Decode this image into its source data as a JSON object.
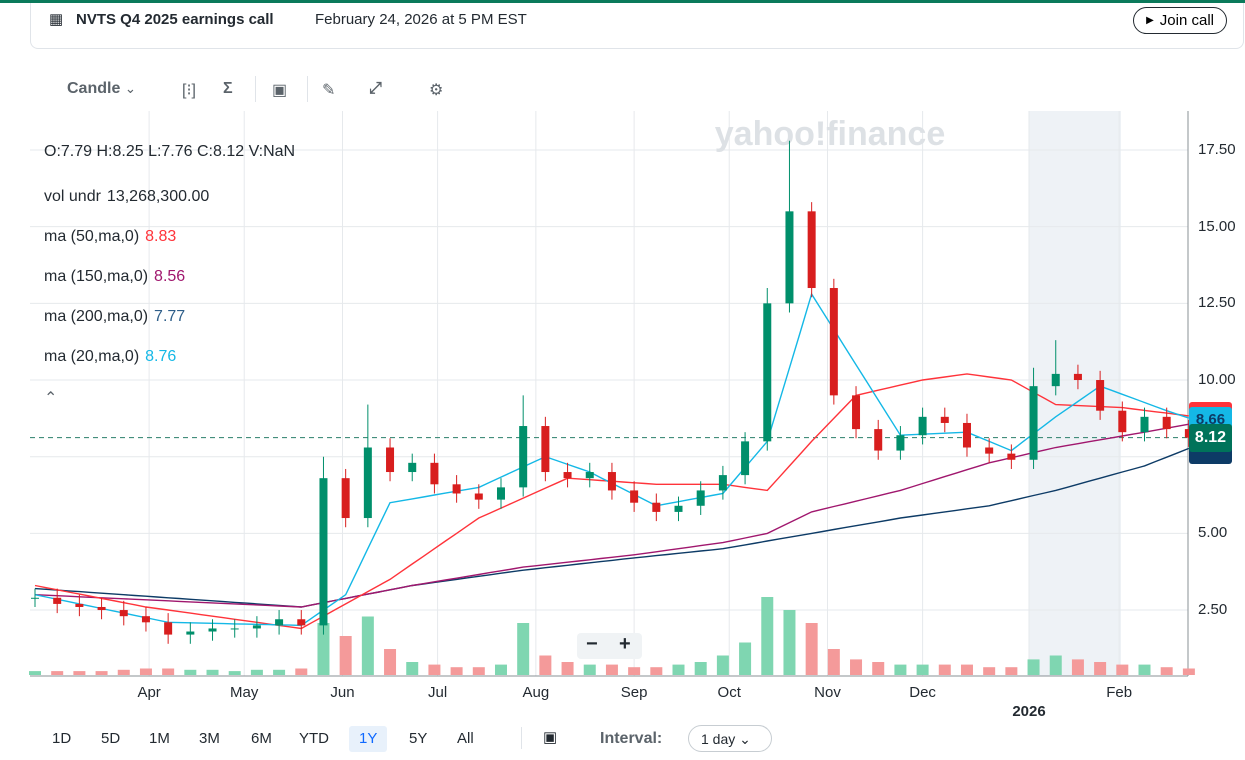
{
  "banner": {
    "title": "NVTS Q4 2025 earnings call",
    "date": "February 24, 2026 at 5 PM EST",
    "join_label": "Join call"
  },
  "toolbar": {
    "chart_type": "Candle"
  },
  "watermark": "yahoo!finance",
  "ohlc": "O:7.79  H:8.25  L:7.76  C:8.12  V:NaN",
  "indicators": [
    {
      "label": "vol undr",
      "value": "13,268,300.00",
      "color": "#232a31"
    },
    {
      "label": "ma (50,ma,0)",
      "value": "8.83",
      "color": "#ff333a"
    },
    {
      "label": "ma (150,ma,0)",
      "value": "8.56",
      "color": "#a0176e"
    },
    {
      "label": "ma (200,ma,0)",
      "value": "7.77",
      "color": "#2f5f8a"
    },
    {
      "label": "ma (20,ma,0)",
      "value": "8.76",
      "color": "#14b8e6"
    }
  ],
  "price_tags": {
    "ma20": "8.66",
    "last": "8.12"
  },
  "colors": {
    "up": "#008f6b",
    "down": "#d81e1e",
    "ma20": "#14b8e6",
    "ma50": "#ff333a",
    "ma150": "#a0176e",
    "ma200": "#0d3b66",
    "last_tag": "#00735a"
  },
  "y_ticks": [
    "17.50",
    "15.00",
    "12.50",
    "10.00",
    "5.00",
    "2.50"
  ],
  "y_tick_values": [
    17.5,
    15,
    12.5,
    10,
    5,
    2.5
  ],
  "x_ticks": [
    "Apr",
    "May",
    "Jun",
    "Jul",
    "Aug",
    "Sep",
    "Oct",
    "Nov",
    "Dec",
    "Feb"
  ],
  "x_tick_days": [
    36,
    66,
    97,
    127,
    158,
    189,
    219,
    250,
    280,
    342
  ],
  "year_label": "2026",
  "range_buttons": [
    "1D",
    "5D",
    "1M",
    "3M",
    "6M",
    "YTD",
    "1Y",
    "5Y",
    "All"
  ],
  "active_range": "1Y",
  "interval_label": "Interval:",
  "interval_value": "1 day",
  "zoom": {
    "minus": "−",
    "plus": "+"
  },
  "chart_data": {
    "type": "candlestick",
    "note": "weekly approximation, weeks from Feb 24 2025",
    "closes": [
      2.9,
      2.7,
      2.6,
      2.5,
      2.3,
      2.1,
      1.7,
      1.8,
      1.9,
      1.9,
      2.0,
      2.2,
      2.0,
      6.8,
      5.5,
      7.8,
      7.0,
      7.3,
      6.6,
      6.3,
      6.1,
      6.5,
      8.5,
      7.0,
      6.8,
      7.0,
      6.4,
      6.0,
      5.7,
      5.9,
      6.4,
      6.9,
      8.0,
      12.5,
      15.5,
      13.0,
      9.5,
      8.4,
      7.7,
      8.2,
      8.8,
      8.6,
      7.8,
      7.6,
      7.4,
      9.8,
      10.2,
      10.0,
      9.0,
      8.3,
      8.8,
      8.4,
      8.12
    ],
    "highs": {
      "13": 7.5,
      "15": 9.2,
      "22": 9.5,
      "33": 13.0,
      "34": 17.8,
      "45": 10.4,
      "46": 11.3
    },
    "volumes_m": [
      3,
      3,
      3,
      3,
      4,
      5,
      5,
      4,
      4,
      3,
      4,
      4,
      5,
      40,
      30,
      45,
      20,
      10,
      8,
      6,
      6,
      8,
      40,
      15,
      10,
      8,
      8,
      6,
      6,
      8,
      10,
      15,
      25,
      60,
      50,
      40,
      20,
      12,
      10,
      8,
      8,
      8,
      8,
      6,
      6,
      12,
      15,
      12,
      10,
      8,
      8,
      6,
      5
    ],
    "ma20": [
      [
        0,
        3.0
      ],
      [
        6,
        2.1
      ],
      [
        12,
        2.0
      ],
      [
        14,
        3.0
      ],
      [
        16,
        6.0
      ],
      [
        20,
        6.5
      ],
      [
        23,
        7.5
      ],
      [
        25,
        7.0
      ],
      [
        28,
        5.9
      ],
      [
        31,
        6.3
      ],
      [
        33,
        8.0
      ],
      [
        35,
        12.8
      ],
      [
        37,
        10.5
      ],
      [
        39,
        8.2
      ],
      [
        42,
        8.3
      ],
      [
        44,
        7.7
      ],
      [
        46,
        8.8
      ],
      [
        48,
        9.8
      ],
      [
        51,
        9.0
      ],
      [
        52,
        8.76
      ]
    ],
    "ma50": [
      [
        0,
        3.3
      ],
      [
        5,
        2.6
      ],
      [
        12,
        1.9
      ],
      [
        16,
        3.5
      ],
      [
        20,
        5.5
      ],
      [
        24,
        6.8
      ],
      [
        28,
        6.6
      ],
      [
        31,
        6.6
      ],
      [
        33,
        6.4
      ],
      [
        35,
        8.0
      ],
      [
        37,
        9.5
      ],
      [
        40,
        10.0
      ],
      [
        42,
        10.2
      ],
      [
        44,
        10.0
      ],
      [
        46,
        9.2
      ],
      [
        49,
        9.1
      ],
      [
        52,
        8.83
      ]
    ],
    "ma150": [
      [
        0,
        3.0
      ],
      [
        12,
        2.6
      ],
      [
        17,
        3.3
      ],
      [
        22,
        3.9
      ],
      [
        27,
        4.3
      ],
      [
        31,
        4.7
      ],
      [
        33,
        5.0
      ],
      [
        35,
        5.7
      ],
      [
        39,
        6.4
      ],
      [
        43,
        7.3
      ],
      [
        46,
        7.8
      ],
      [
        50,
        8.3
      ],
      [
        52,
        8.56
      ]
    ],
    "ma200": [
      [
        0,
        3.2
      ],
      [
        12,
        2.6
      ],
      [
        17,
        3.3
      ],
      [
        22,
        3.8
      ],
      [
        27,
        4.2
      ],
      [
        31,
        4.5
      ],
      [
        35,
        5.0
      ],
      [
        39,
        5.5
      ],
      [
        43,
        5.9
      ],
      [
        46,
        6.4
      ],
      [
        50,
        7.2
      ],
      [
        52,
        7.77
      ]
    ],
    "ylim": [
      0.5,
      18.5
    ]
  }
}
